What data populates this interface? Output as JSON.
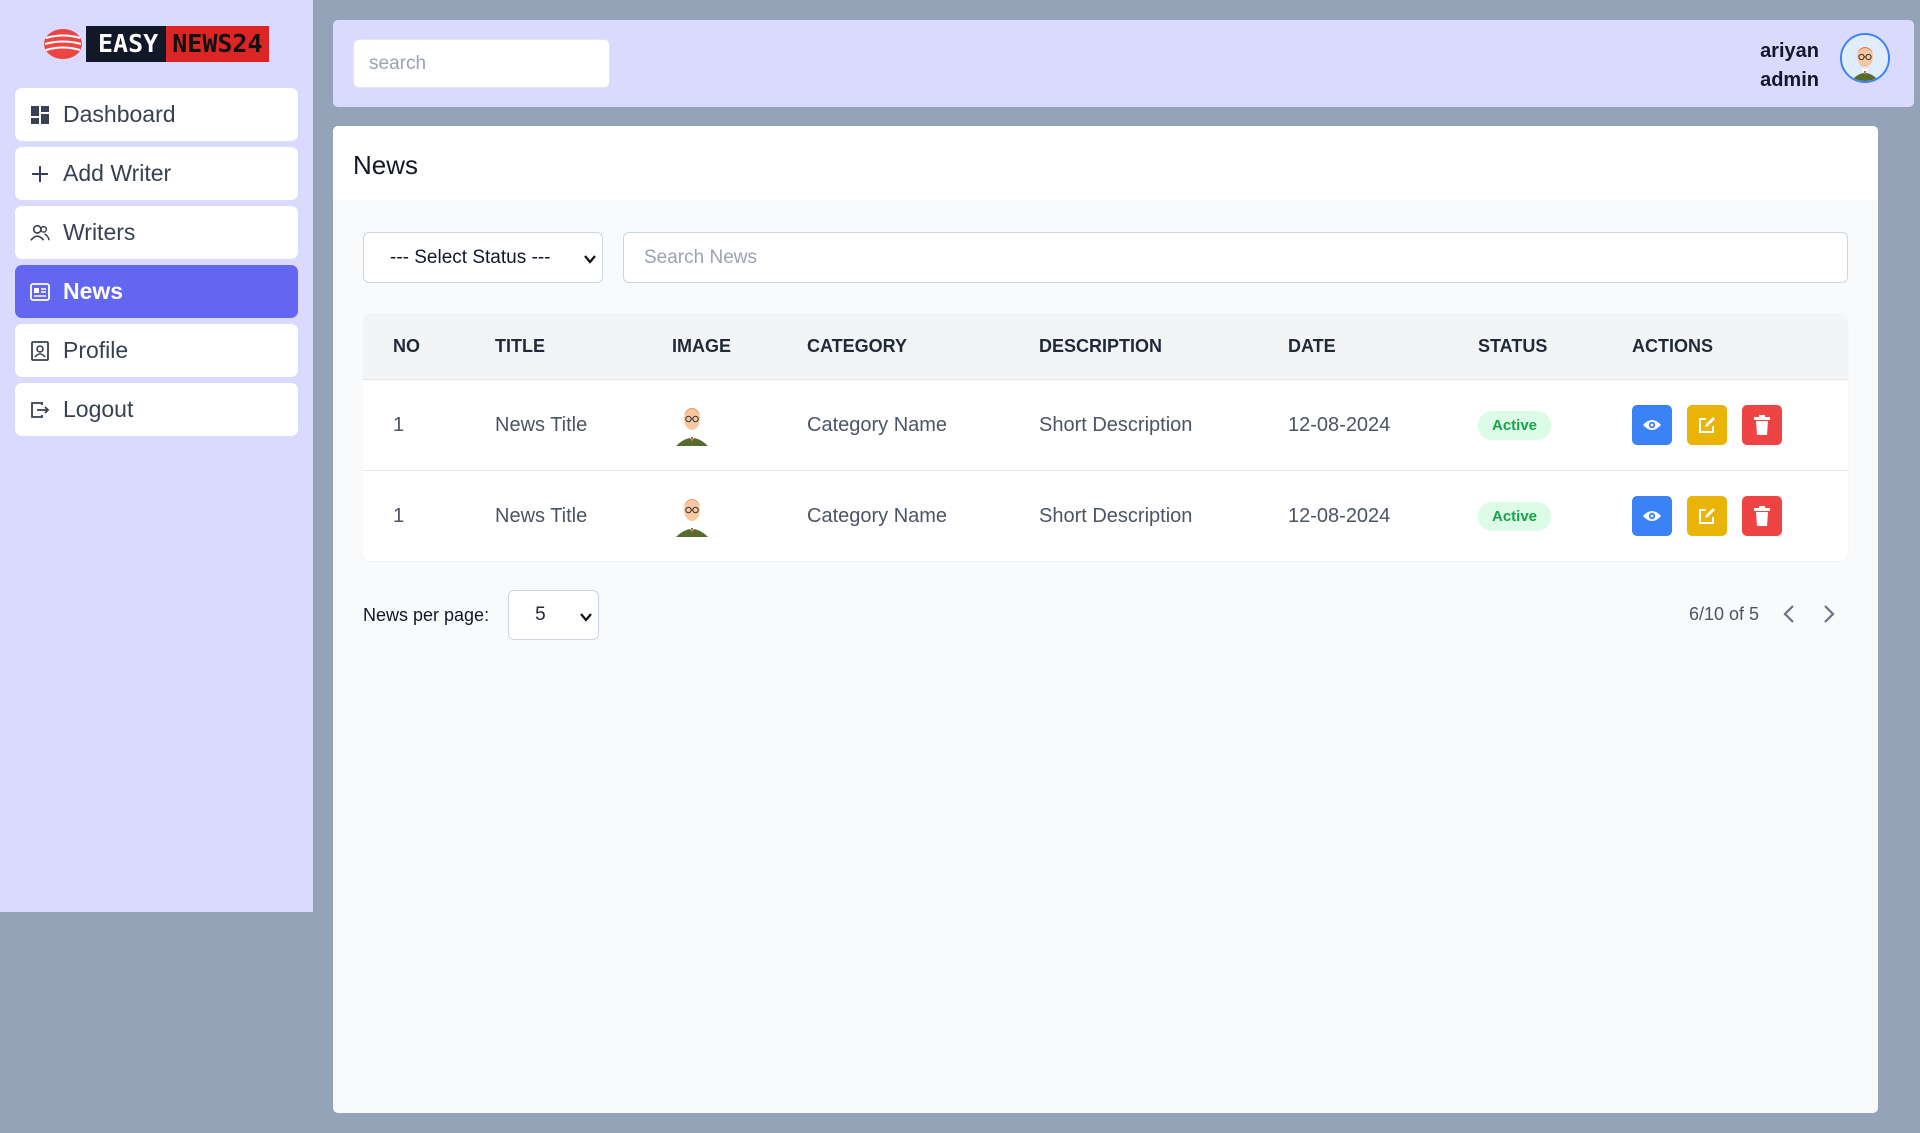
{
  "brand": {
    "part1": "EASY",
    "part2": "NEWS24"
  },
  "sidebar": {
    "items": [
      {
        "label": "Dashboard",
        "icon": "dashboard-icon"
      },
      {
        "label": "Add Writer",
        "icon": "plus-icon"
      },
      {
        "label": "Writers",
        "icon": "users-icon"
      },
      {
        "label": "News",
        "icon": "newspaper-icon",
        "active": true
      },
      {
        "label": "Profile",
        "icon": "profile-icon"
      },
      {
        "label": "Logout",
        "icon": "logout-icon"
      }
    ]
  },
  "header": {
    "search_placeholder": "search",
    "user_name": "ariyan",
    "user_role": "admin"
  },
  "main": {
    "title": "News",
    "status_select": "--- Select Status ---",
    "search_placeholder": "Search News",
    "columns": [
      "NO",
      "TITLE",
      "IMAGE",
      "CATEGORY",
      "DESCRIPTION",
      "DATE",
      "STATUS",
      "ACTIONS"
    ],
    "rows": [
      {
        "no": "1",
        "title": "News Title",
        "category": "Category Name",
        "description": "Short Description",
        "date": "12-08-2024",
        "status": "Active"
      },
      {
        "no": "1",
        "title": "News Title",
        "category": "Category Name",
        "description": "Short Description",
        "date": "12-08-2024",
        "status": "Active"
      }
    ],
    "per_page_label": "News per page:",
    "per_page_value": "5",
    "range_text": "6/10 of 5"
  },
  "colors": {
    "sidebar_bg": "#dadaff",
    "active_nav": "#6366f1",
    "view_button": "#3b82f6",
    "edit_button": "#eab308",
    "delete_button": "#ef4444",
    "status_active": "#16a34a"
  }
}
